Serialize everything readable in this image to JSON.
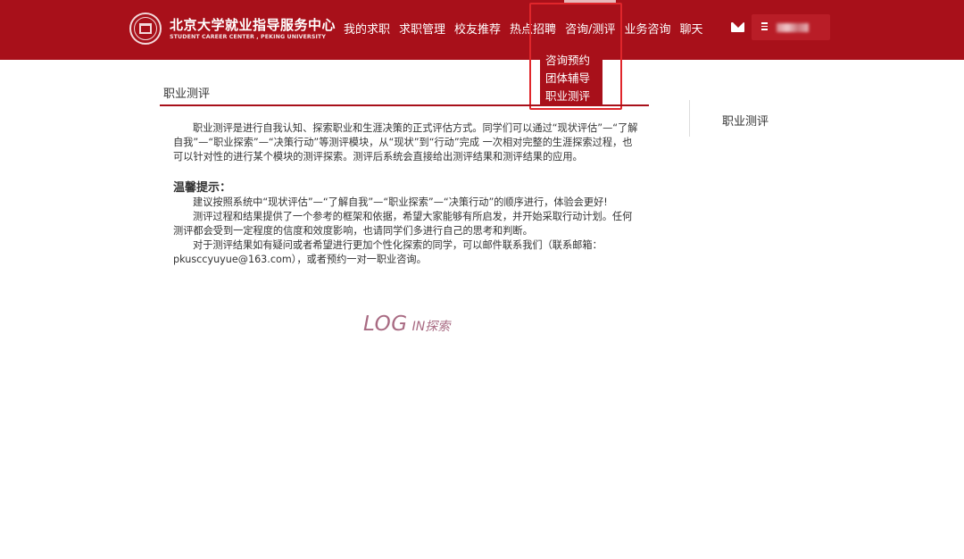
{
  "header": {
    "brand_cn": "北京大学就业指导服务中心",
    "brand_en": "STUDENT CAREER CENTER , PEKING UNIVERSITY",
    "nav": [
      {
        "label": "我的求职"
      },
      {
        "label": "求职管理"
      },
      {
        "label": "校友推荐"
      },
      {
        "label": "热点招聘"
      },
      {
        "label": "咨询/测评",
        "active": true
      },
      {
        "label": "业务咨询"
      },
      {
        "label": "聊天"
      }
    ],
    "icons": {
      "mail": "mail-icon",
      "menu": "menu-icon"
    }
  },
  "dropdown": {
    "items": [
      "咨询预约",
      "团体辅导",
      "职业测评"
    ]
  },
  "main": {
    "title": "职业测评",
    "intro": "职业测评是进行自我认知、探索职业和生涯决策的正式评估方式。同学们可以通过“现状评估”—“了解自我”—“职业探索”—“决策行动”等测评模块，从“现状”到“行动”完成 一次相对完整的生涯探索过程，也可以针对性的进行某个模块的测评探索。测评后系统会直接给出测评结果和测评结果的应用。",
    "tips_title": "温馨提示：",
    "tips": [
      "建议按照系统中“现状评估”—“了解自我”—“职业探索”—“决策行动”的顺序进行，体验会更好!",
      "测评过程和结果提供了一个参考的框架和依据，希望大家能够有所启发，并开始采取行动计划。任何测评都会受到一定程度的信度和效度影响，也请同学们多进行自己的思考和判断。",
      "对于测评结果如有疑问或者希望进行更加个性化探索的同学，可以邮件联系我们（联系邮箱：pkusccyuyue@163.com），或者预约一对一职业咨询。"
    ],
    "login_big": "LOG",
    "login_small": "IN探索"
  },
  "sidebar": {
    "items": [
      {
        "label": "职业测评"
      }
    ]
  },
  "colors": {
    "brand": "#a8101a",
    "highlight": "#e0262b",
    "login": "#a86a82"
  }
}
